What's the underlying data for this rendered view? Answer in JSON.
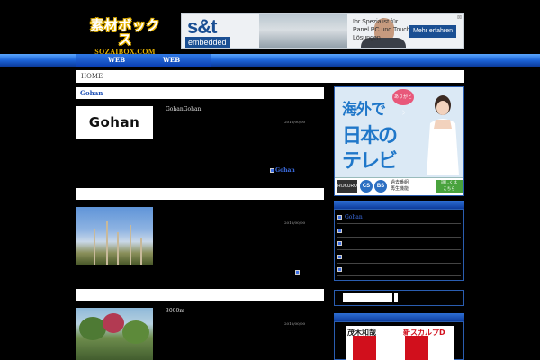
{
  "header": {
    "logo_jp": "素材ボックス",
    "logo_en": "SOZAIBOX.COM"
  },
  "top_ad": {
    "brand": "s&t",
    "sub": "embedded",
    "text": "Ihr Spezialist für Panel PC und Touch-Lösungen",
    "button": "Mehr erfahren",
    "close": "⊠"
  },
  "nav": {
    "items": [
      {
        "label": "WEB"
      },
      {
        "label": "WEB"
      }
    ],
    "accent": "#1c64d8"
  },
  "breadcrumb": {
    "home": "HOME"
  },
  "main": {
    "section_title": "Gohan",
    "posts": [
      {
        "thumb_text": "Gohan",
        "title": "GohanGohan",
        "date": "2016/00/00",
        "more": "Gohan"
      },
      {
        "title": "",
        "date": "2016/00/00"
      },
      {
        "title": "3000m",
        "date": "2016/00/00"
      }
    ]
  },
  "sidebar": {
    "ad": {
      "bubble": "ありがとう",
      "line1": "海外で",
      "line2": "日本の",
      "line3": "テレビ",
      "logo": "ROKUROKU",
      "cs": "CS",
      "bs": "BS",
      "txt1": "過去番組",
      "txt2": "再生機能",
      "btn1": "詳しくは",
      "btn2": "こちら"
    },
    "categories": [
      {
        "label": "Gohan"
      },
      {
        "label": ""
      },
      {
        "label": ""
      },
      {
        "label": ""
      },
      {
        "label": ""
      }
    ],
    "ad2": {
      "t1": "茂木和哉",
      "t2": "新スカルプD"
    }
  }
}
